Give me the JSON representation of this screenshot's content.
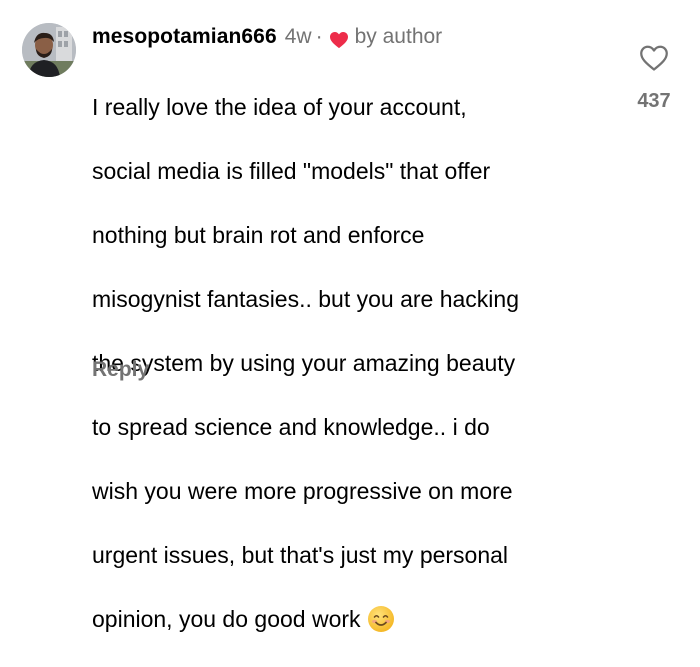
{
  "comment": {
    "username": "mesopotamian666",
    "time_ago": "4w",
    "separator": "·",
    "author_badge": "by author",
    "text_lines": [
      "I really love the idea of your account,",
      "social media is filled \"models\" that offer",
      "nothing but brain rot and enforce",
      "misogynist fantasies.. but you are hacking",
      "the system by using your amazing beauty",
      "to spread science and knowledge.. i do",
      "wish you were more progressive on more",
      "urgent issues, but that's just my personal",
      "opinion, you do good work"
    ],
    "emoji": "smiling-face-emoji",
    "reply_label": "Reply",
    "like_count": "437",
    "like_icon": "heart-outline-icon",
    "author_heart_icon": "heart-filled-icon"
  },
  "colors": {
    "heart_red": "#ed2c4a",
    "meta_gray": "#737373",
    "text": "#000000",
    "emoji_yellow": "#f9c43a"
  }
}
